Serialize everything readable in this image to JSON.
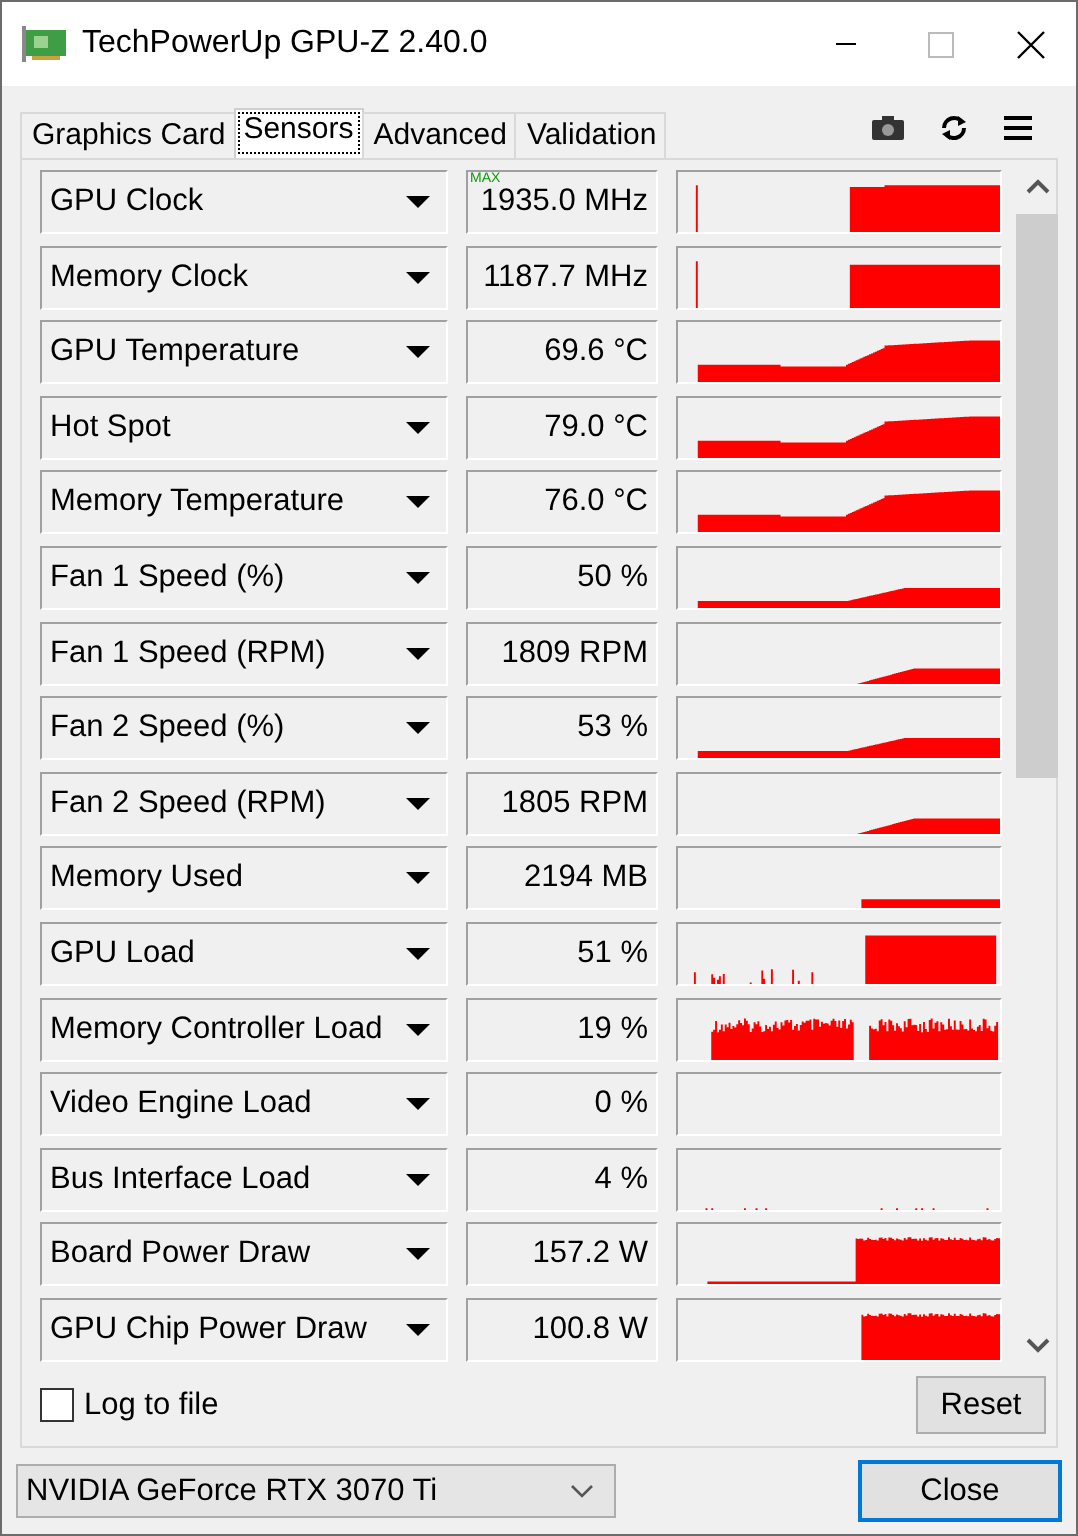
{
  "window": {
    "title": "TechPowerUp GPU-Z 2.40.0"
  },
  "tabs": [
    {
      "label": "Graphics Card",
      "selected": false
    },
    {
      "label": "Sensors",
      "selected": true
    },
    {
      "label": "Advanced",
      "selected": false
    },
    {
      "label": "Validation",
      "selected": false
    }
  ],
  "sensors": [
    {
      "name": "GPU Clock",
      "value": "1935.0 MHz",
      "badge": "MAX",
      "kind": "clock"
    },
    {
      "name": "Memory Clock",
      "value": "1187.7 MHz",
      "kind": "memclock"
    },
    {
      "name": "GPU Temperature",
      "value": "69.6 °C",
      "kind": "temp"
    },
    {
      "name": "Hot Spot",
      "value": "79.0 °C",
      "kind": "temp"
    },
    {
      "name": "Memory Temperature",
      "value": "76.0 °C",
      "kind": "temp"
    },
    {
      "name": "Fan 1 Speed (%)",
      "value": "50 %",
      "kind": "fan"
    },
    {
      "name": "Fan 1 Speed (RPM)",
      "value": "1809 RPM",
      "kind": "rpm"
    },
    {
      "name": "Fan 2 Speed (%)",
      "value": "53 %",
      "kind": "fan"
    },
    {
      "name": "Fan 2 Speed (RPM)",
      "value": "1805 RPM",
      "kind": "rpm"
    },
    {
      "name": "Memory Used",
      "value": "2194 MB",
      "kind": "used"
    },
    {
      "name": "GPU Load",
      "value": "51 %",
      "kind": "load"
    },
    {
      "name": "Memory Controller Load",
      "value": "19 %",
      "kind": "noise"
    },
    {
      "name": "Video Engine Load",
      "value": "0 %",
      "kind": "empty"
    },
    {
      "name": "Bus Interface Load",
      "value": "4 %",
      "kind": "blips"
    },
    {
      "name": "Board Power Draw",
      "value": "157.2 W",
      "kind": "power"
    },
    {
      "name": "GPU Chip Power Draw",
      "value": "100.8 W",
      "kind": "chip"
    }
  ],
  "log_to_file": {
    "label": "Log to file",
    "checked": false
  },
  "reset_button": "Reset",
  "gpu_select": {
    "value": "NVIDIA GeForce RTX 3070 Ti"
  },
  "close_button": "Close"
}
